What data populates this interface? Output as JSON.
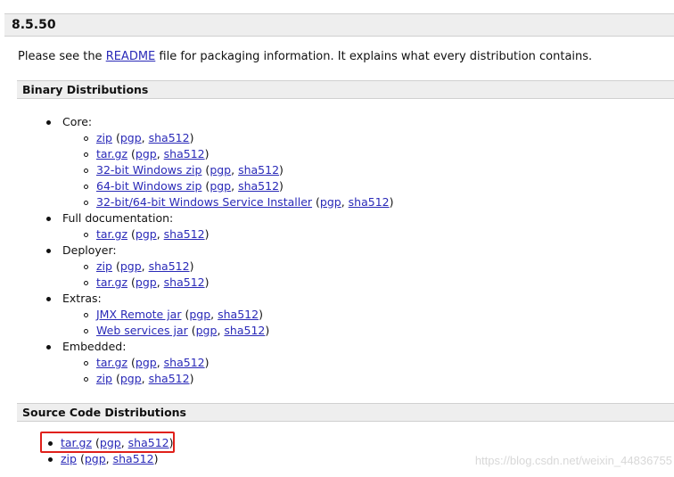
{
  "version": "8.5.50",
  "intro": {
    "before": "Please see the ",
    "link": "README",
    "after": " file for packaging information. It explains what every distribution contains."
  },
  "binary_heading": "Binary Distributions",
  "source_heading": "Source Code Distributions",
  "binary": [
    {
      "label": "Core:",
      "items": [
        {
          "name": "zip",
          "sig": "pgp",
          "hash": "sha512"
        },
        {
          "name": "tar.gz",
          "sig": "pgp",
          "hash": "sha512"
        },
        {
          "name": "32-bit Windows zip",
          "sig": "pgp",
          "hash": "sha512"
        },
        {
          "name": "64-bit Windows zip",
          "sig": "pgp",
          "hash": "sha512"
        },
        {
          "name": "32-bit/64-bit Windows Service Installer",
          "sig": "pgp",
          "hash": "sha512"
        }
      ]
    },
    {
      "label": "Full documentation:",
      "items": [
        {
          "name": "tar.gz",
          "sig": "pgp",
          "hash": "sha512"
        }
      ]
    },
    {
      "label": "Deployer:",
      "items": [
        {
          "name": "zip",
          "sig": "pgp",
          "hash": "sha512"
        },
        {
          "name": "tar.gz",
          "sig": "pgp",
          "hash": "sha512"
        }
      ]
    },
    {
      "label": "Extras:",
      "items": [
        {
          "name": "JMX Remote jar",
          "sig": "pgp",
          "hash": "sha512"
        },
        {
          "name": "Web services jar",
          "sig": "pgp",
          "hash": "sha512"
        }
      ]
    },
    {
      "label": "Embedded:",
      "items": [
        {
          "name": "tar.gz",
          "sig": "pgp",
          "hash": "sha512"
        },
        {
          "name": "zip",
          "sig": "pgp",
          "hash": "sha512"
        }
      ]
    }
  ],
  "source": [
    {
      "name": "tar.gz",
      "sig": "pgp",
      "hash": "sha512"
    },
    {
      "name": "zip",
      "sig": "pgp",
      "hash": "sha512"
    }
  ],
  "watermark": "https://blog.csdn.net/weixin_44836755",
  "colors": {
    "link": "#2a2ab8",
    "highlight": "#e0201a",
    "bar": "#eeeeee"
  }
}
